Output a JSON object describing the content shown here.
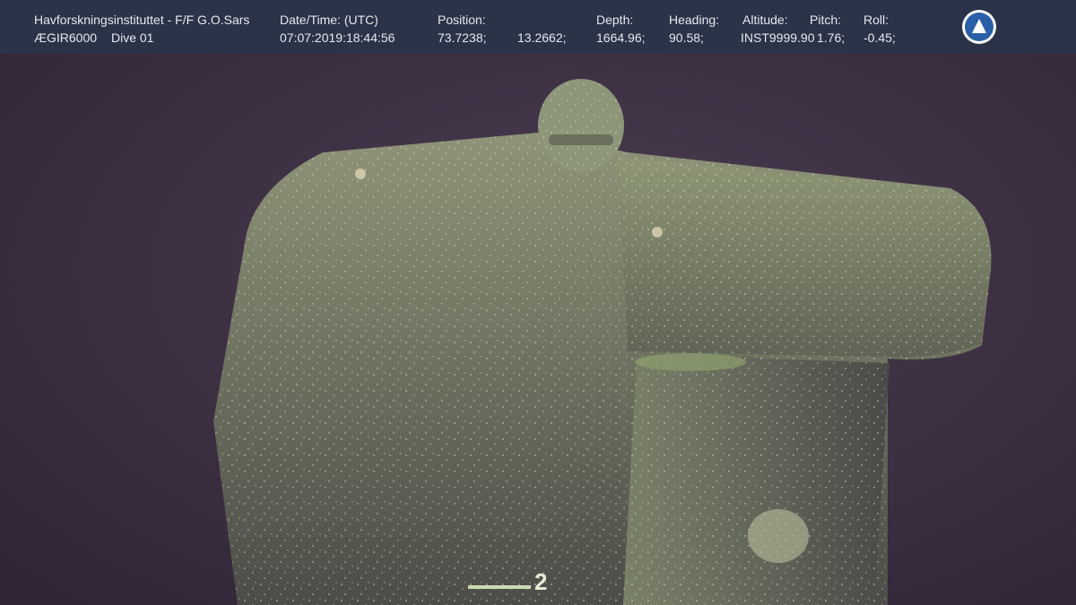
{
  "overlay": {
    "institute": "Havforskningsinstituttet - F/F G.O.Sars",
    "vehicle": "ÆGIR6000",
    "dive": "Dive 01",
    "datetime_label": "Date/Time: (UTC)",
    "datetime_value": "07:07:2019:18:44:56",
    "position_label": "Position:",
    "latitude": "73.7238;",
    "longitude": "13.2662;",
    "depth_label": "Depth:",
    "depth_value": "1664.96;",
    "heading_label": "Heading:",
    "heading_value": "90.58;",
    "altitude_label": "Altitude:",
    "altitude_value": "INST9999.90",
    "pitch_label": "Pitch:",
    "pitch_value": "1.76;",
    "roll_label": "Roll:",
    "roll_value": "-0.45;"
  },
  "scale": {
    "label": "2"
  },
  "logo": {
    "icon": "institute-emblem-icon",
    "color": "#2a5fa8"
  },
  "colors": {
    "overlay_bg": "#2a3347",
    "water": "#3e3144",
    "growth": "#9ea487"
  }
}
